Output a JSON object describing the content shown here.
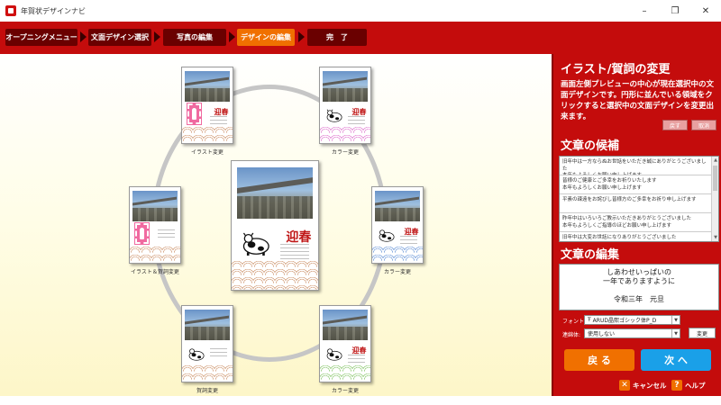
{
  "window": {
    "title": "年賀状デザインナビ",
    "controls": [
      "–",
      "❐",
      "✕"
    ]
  },
  "steps": [
    {
      "label": "オープニングメニュー",
      "active": false
    },
    {
      "label": "文面デザイン選択",
      "active": false
    },
    {
      "label": "写真の編集",
      "active": false
    },
    {
      "label": "デザインの編集",
      "active": true
    },
    {
      "label": "完　了",
      "active": false
    }
  ],
  "preview": {
    "card_text": "迎春",
    "captions": {
      "top_left": "イラスト変更",
      "top_right": "カラー変更",
      "left": "イラスト＆賀詞変更",
      "right": "カラー変更",
      "bottom_left": "賀詞変更",
      "bottom_right": "カラー変更"
    }
  },
  "panel": {
    "heading_illust": "イラスト/賀詞の変更",
    "description": "画面左側プレビューの中心が現在選択中の文面デザインです。円形に並んでいる領域をクリックすると選択中の文面デザインを変更出来ます。",
    "btn_undo": "戻す",
    "btn_cancel_small": "取消",
    "heading_candidates": "文章の候補",
    "candidates": [
      "旧年中は一方ならぬお世話をいただき誠にありがとうございました\n本年もよろしくお願い申し上げます",
      "皆様のご健康とご多幸をお祈りいたします\n本年もよろしくお願い申し上げます",
      "平素の疎遠をお詫びし皆様方のご多幸をお祈り申し上げます",
      "昨年中はいろいろご教示いただきありがとうございました\n本年もよろしくご指導のほどお願い申し上げます",
      "旧年中は大変お世話になりありがとうございました\n本年も相変わらずご指導のほどお願い申し上げます"
    ],
    "heading_edit": "文章の編集",
    "edit_lines": [
      "しあわせいっぱいの",
      "一年でありますように",
      "",
      "令和三年　元旦"
    ],
    "font_label": "フォント:",
    "font_value": "ARUD晶熙ゴシック体P_D",
    "font_prefix_icon": "Ŧ",
    "renmei_label": "連綿体:",
    "renmei_value": "使用しない",
    "btn_change": "変更",
    "btn_back": "戻 る",
    "btn_next": "次 へ",
    "btn_cancel": "キャンセル",
    "btn_help": "ヘルプ"
  },
  "colors": {
    "brand_red": "#c40c0c",
    "step_dark": "#6a0000",
    "step_active": "#f07000",
    "back_button": "#f07000",
    "next_button": "#1aa0e8",
    "cancel_icon": "#f07000",
    "help_icon": "#f07000"
  }
}
